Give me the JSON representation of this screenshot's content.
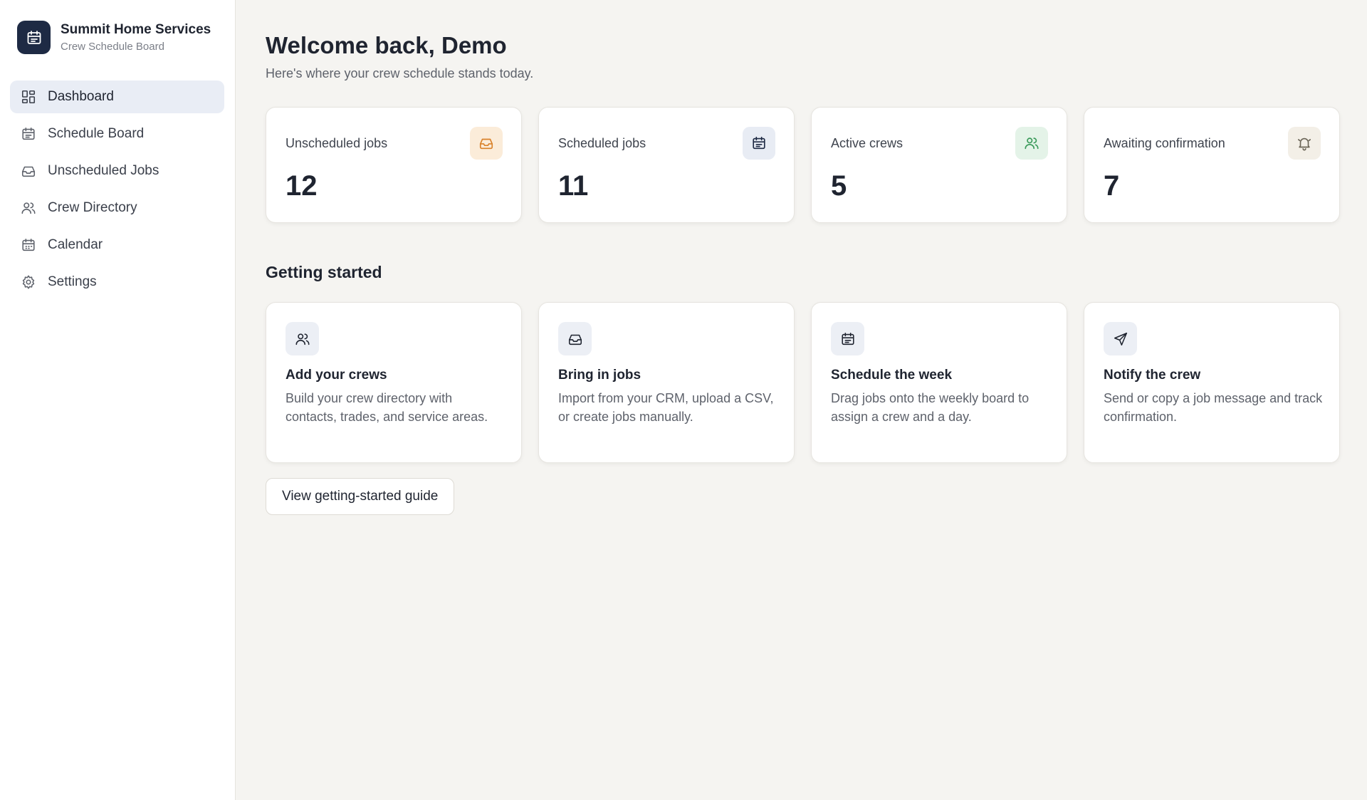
{
  "brand": {
    "name": "Summit Home Services",
    "subtitle": "Crew Schedule Board",
    "logo_icon": "calendar-icon"
  },
  "sidebar": {
    "items": [
      {
        "label": "Dashboard",
        "icon": "dashboard-icon",
        "active": true
      },
      {
        "label": "Schedule Board",
        "icon": "calendar-icon",
        "active": false
      },
      {
        "label": "Unscheduled Jobs",
        "icon": "inbox-icon",
        "active": false
      },
      {
        "label": "Crew Directory",
        "icon": "users-icon",
        "active": false
      },
      {
        "label": "Calendar",
        "icon": "calendar-icon",
        "active": false
      },
      {
        "label": "Settings",
        "icon": "gear-icon",
        "active": false
      }
    ]
  },
  "header": {
    "title": "Welcome back, Demo",
    "subtitle": "Here's where your crew schedule stands today."
  },
  "stats": [
    {
      "label": "Unscheduled jobs",
      "value": "12",
      "icon": "inbox-icon",
      "icon_bg": "#fbecd9",
      "icon_color": "#d9822b"
    },
    {
      "label": "Scheduled jobs",
      "value": "11",
      "icon": "calendar-icon",
      "icon_bg": "#e8ecf4",
      "icon_color": "#1e2a44"
    },
    {
      "label": "Active crews",
      "value": "5",
      "icon": "users-icon",
      "icon_bg": "#e4f3e8",
      "icon_color": "#3a9a5a"
    },
    {
      "label": "Awaiting confirmation",
      "value": "7",
      "icon": "bell-icon",
      "icon_bg": "#f3efe7",
      "icon_color": "#6b6557"
    }
  ],
  "getting_started": {
    "title": "Getting started",
    "cards": [
      {
        "title": "Add your crews",
        "description": "Build your crew directory with contacts, trades, and service areas.",
        "icon": "users-icon"
      },
      {
        "title": "Bring in jobs",
        "description": "Import from your CRM, upload a CSV, or create jobs manually.",
        "icon": "inbox-icon"
      },
      {
        "title": "Schedule the week",
        "description": "Drag jobs onto the weekly board to assign a crew and a day.",
        "icon": "calendar-icon"
      },
      {
        "title": "Notify the crew",
        "description": "Send or copy a job message and track confirmation.",
        "icon": "send-icon"
      }
    ],
    "button_label": "View getting-started guide"
  },
  "colors": {
    "brand": "#1e2a44",
    "active_nav_bg": "#e9edf5",
    "page_bg": "#f5f4f1"
  }
}
